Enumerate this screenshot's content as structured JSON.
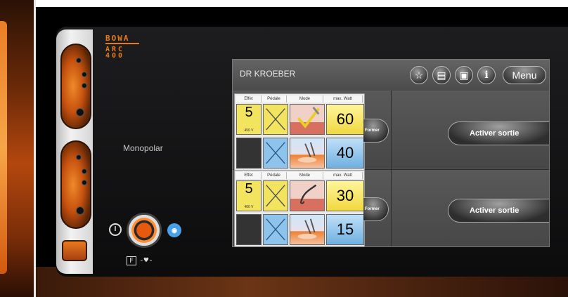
{
  "device": {
    "brand": "BOWA",
    "model_line1": "ARC",
    "model_line2": "400",
    "mode_label": "Monopolar"
  },
  "icons": {
    "power": "power-icon",
    "knob": "rotary-knob-icon",
    "argon": "argon-icon",
    "footswitch": "footswitch-icon",
    "favorite": "star-icon",
    "book": "book-icon",
    "lock": "lock-icon",
    "info": "info-icon"
  },
  "footer": {
    "f_label": "F"
  },
  "screen": {
    "doctor_name": "DR KROEBER",
    "menu_label": "Menu",
    "info_label": "i",
    "column_headers": {
      "effect": "Effet",
      "pedal": "Pédale",
      "mode": "Mode",
      "max_watt": "max. Watt"
    },
    "channels": [
      {
        "former_label": "Former",
        "activer_label": "Activer sortie",
        "rows": [
          {
            "effect": "5",
            "effect_sub": "450 V",
            "watt": "60",
            "color": "#f0d840"
          },
          {
            "effect": "",
            "effect_sub": "",
            "watt": "40",
            "color": "#6fb0e0"
          }
        ]
      },
      {
        "former_label": "Former",
        "activer_label": "Activer sortie",
        "rows": [
          {
            "effect": "5",
            "effect_sub": "400 V",
            "watt": "30",
            "color": "#f0d840"
          },
          {
            "effect": "",
            "effect_sub": "",
            "watt": "15",
            "color": "#6fb0e0"
          }
        ]
      }
    ]
  },
  "colors": {
    "brand_orange": "#e67a1c",
    "cut_yellow": "#f0d840",
    "coag_blue": "#6fb0e0"
  }
}
